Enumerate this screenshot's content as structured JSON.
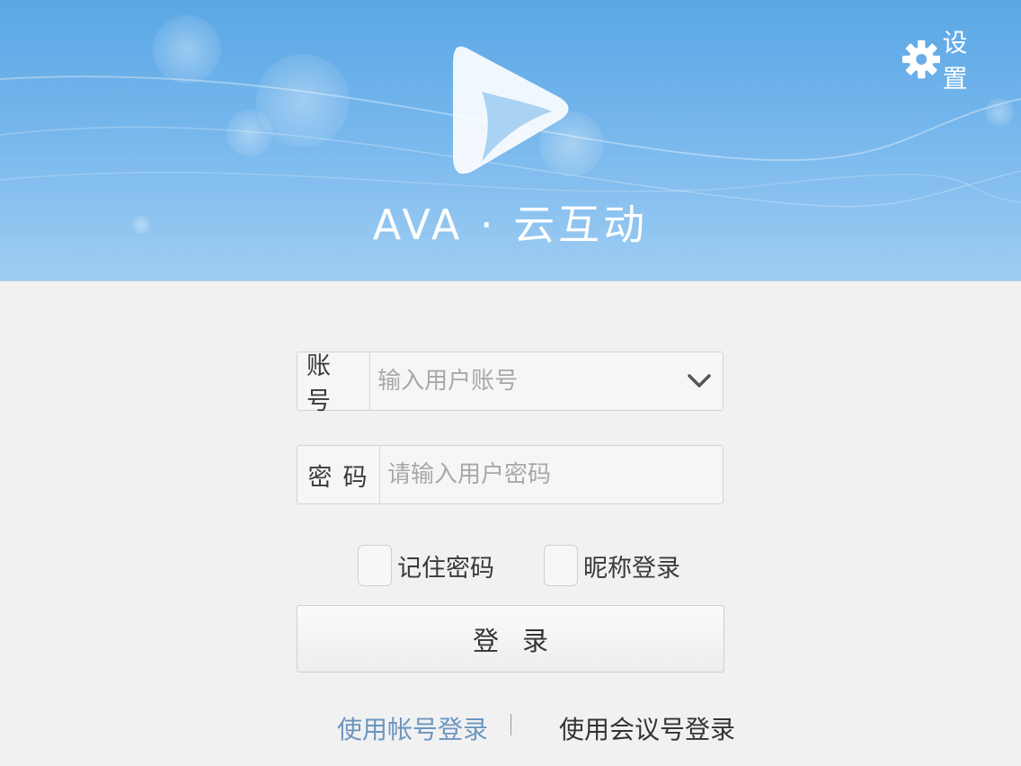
{
  "header": {
    "brand": "AVA · 云互动",
    "settings_label": "设 置"
  },
  "form": {
    "account_label": "账号",
    "account_placeholder": "输入用户账号",
    "password_label": "密码",
    "password_placeholder": "请输入用户密码",
    "remember_label": "记住密码",
    "nickname_label": "昵称登录",
    "login_label": "登录"
  },
  "modes": {
    "account_login": "使用帐号登录",
    "meeting_login": "使用会议号登录"
  },
  "colors": {
    "banner_top": "#5aa7e5",
    "banner_bottom": "#9fcdf3",
    "page_bg": "#f1f1f2",
    "active_link": "#6b96bf"
  }
}
